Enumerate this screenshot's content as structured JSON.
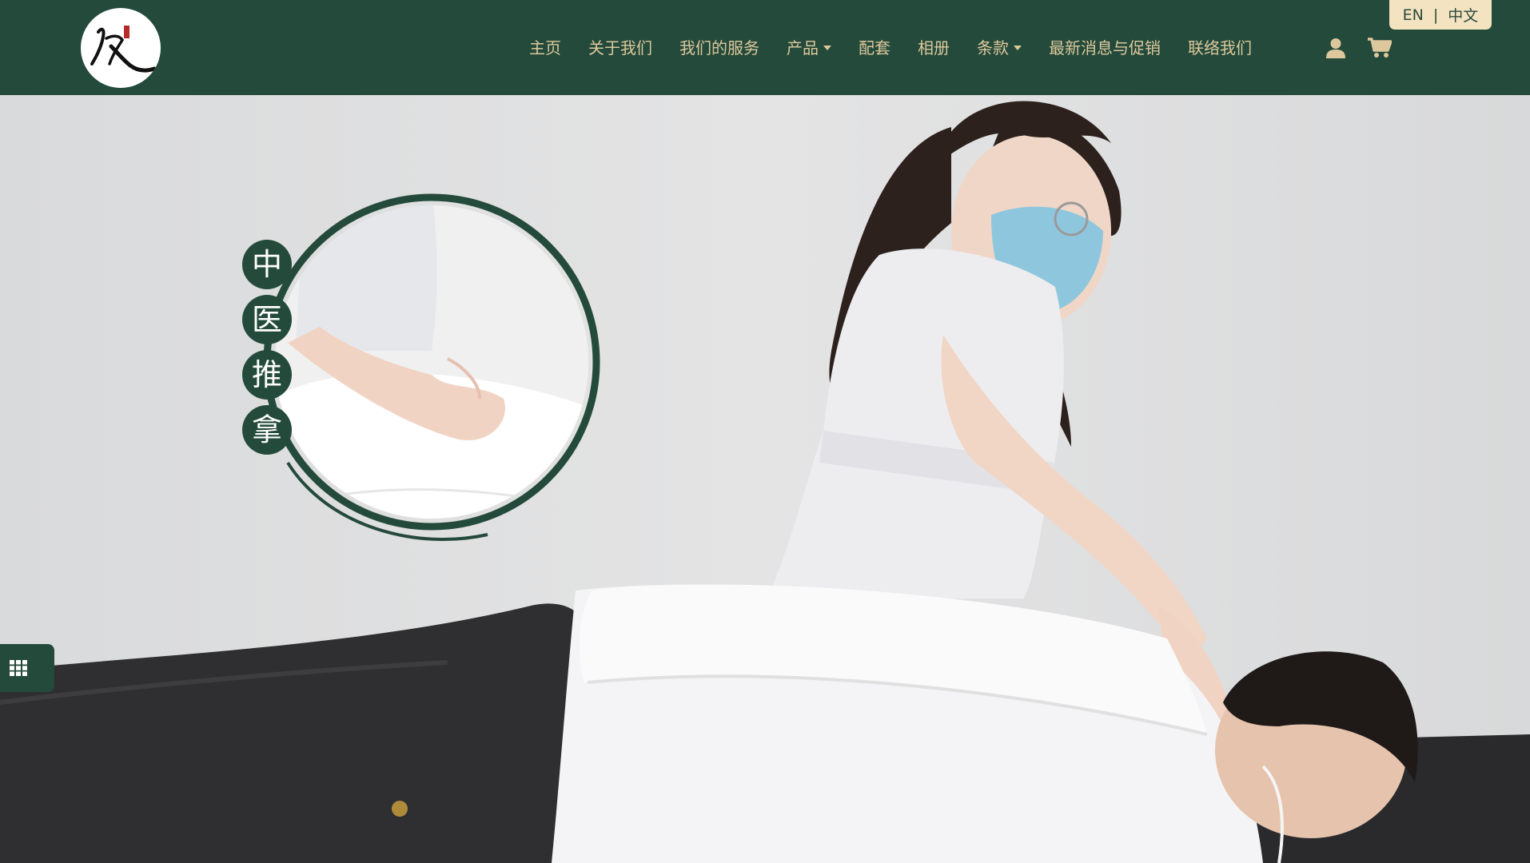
{
  "header": {
    "logo_name": "logo",
    "nav": [
      {
        "label": "主页",
        "has_dropdown": false
      },
      {
        "label": "关于我们",
        "has_dropdown": false
      },
      {
        "label": "我们的服务",
        "has_dropdown": false
      },
      {
        "label": "产品",
        "has_dropdown": true
      },
      {
        "label": "配套",
        "has_dropdown": false
      },
      {
        "label": "相册",
        "has_dropdown": false
      },
      {
        "label": "条款",
        "has_dropdown": true
      },
      {
        "label": "最新消息与促销",
        "has_dropdown": false
      },
      {
        "label": "联络我们",
        "has_dropdown": false
      }
    ],
    "icons": [
      "user-icon",
      "cart-icon"
    ],
    "lang": {
      "en": "EN",
      "separator": "|",
      "zh": "中文"
    }
  },
  "hero": {
    "badge_chars": [
      "中",
      "医",
      "推",
      "拿"
    ],
    "menu_icon": "grid-icon"
  },
  "colors": {
    "brand_green": "#244a3b",
    "nav_text": "#dcc89c",
    "lang_bg": "#f3e3c1",
    "hero_bg": "#dddedf"
  }
}
